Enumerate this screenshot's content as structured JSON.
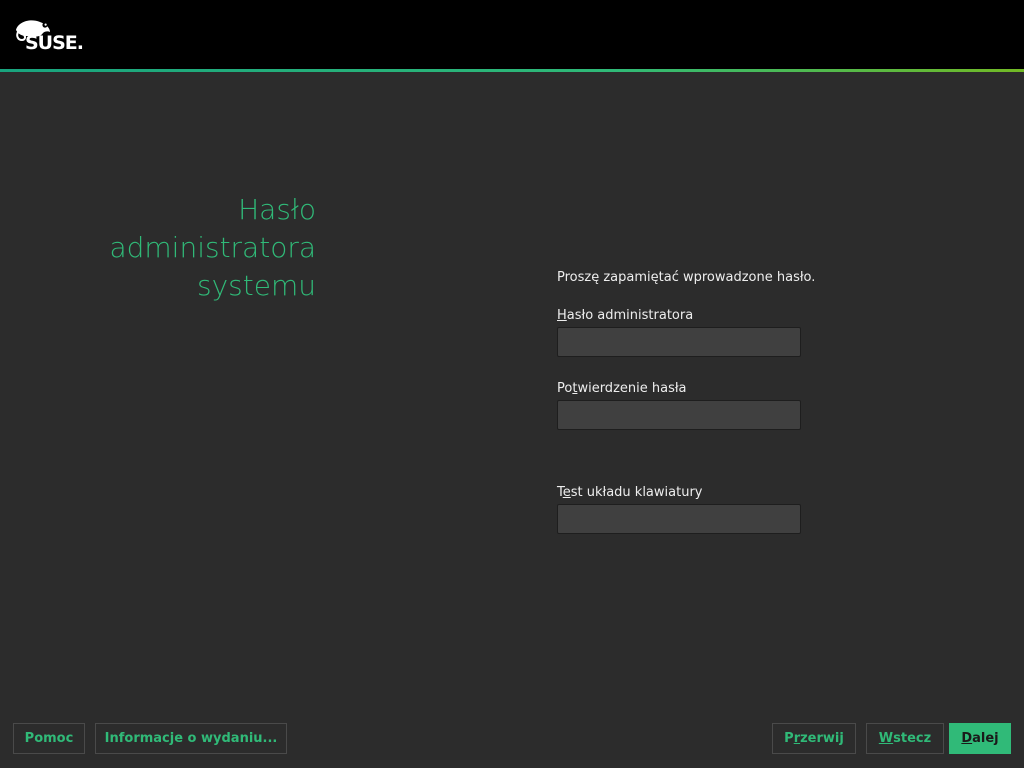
{
  "header": {
    "logo_text": "SUSE.",
    "brand_color": "#30ba78",
    "logo_icon": "suse-chameleon-icon"
  },
  "page": {
    "title_lines": [
      "Hasło",
      "administratora",
      "systemu"
    ]
  },
  "form": {
    "info_text": "Proszę zapamiętać wprowadzone hasło.",
    "password_label_mnemonic": "H",
    "password_label_rest": "asło administratora",
    "password_value": "",
    "confirm_label_pre": "Po",
    "confirm_label_mnemonic": "t",
    "confirm_label_rest": "wierdzenie hasła",
    "confirm_value": "",
    "keyboard_label_pre": "T",
    "keyboard_label_mnemonic": "e",
    "keyboard_label_rest": "st układu klawiatury",
    "keyboard_value": ""
  },
  "footer": {
    "help_label": "Pomoc",
    "release_notes_label": "Informacje o wydaniu...",
    "abort_pre": "P",
    "abort_mnemonic": "r",
    "abort_rest": "zerwij",
    "back_mnemonic": "W",
    "back_rest": "stecz",
    "next_mnemonic": "D",
    "next_rest": "alej"
  }
}
